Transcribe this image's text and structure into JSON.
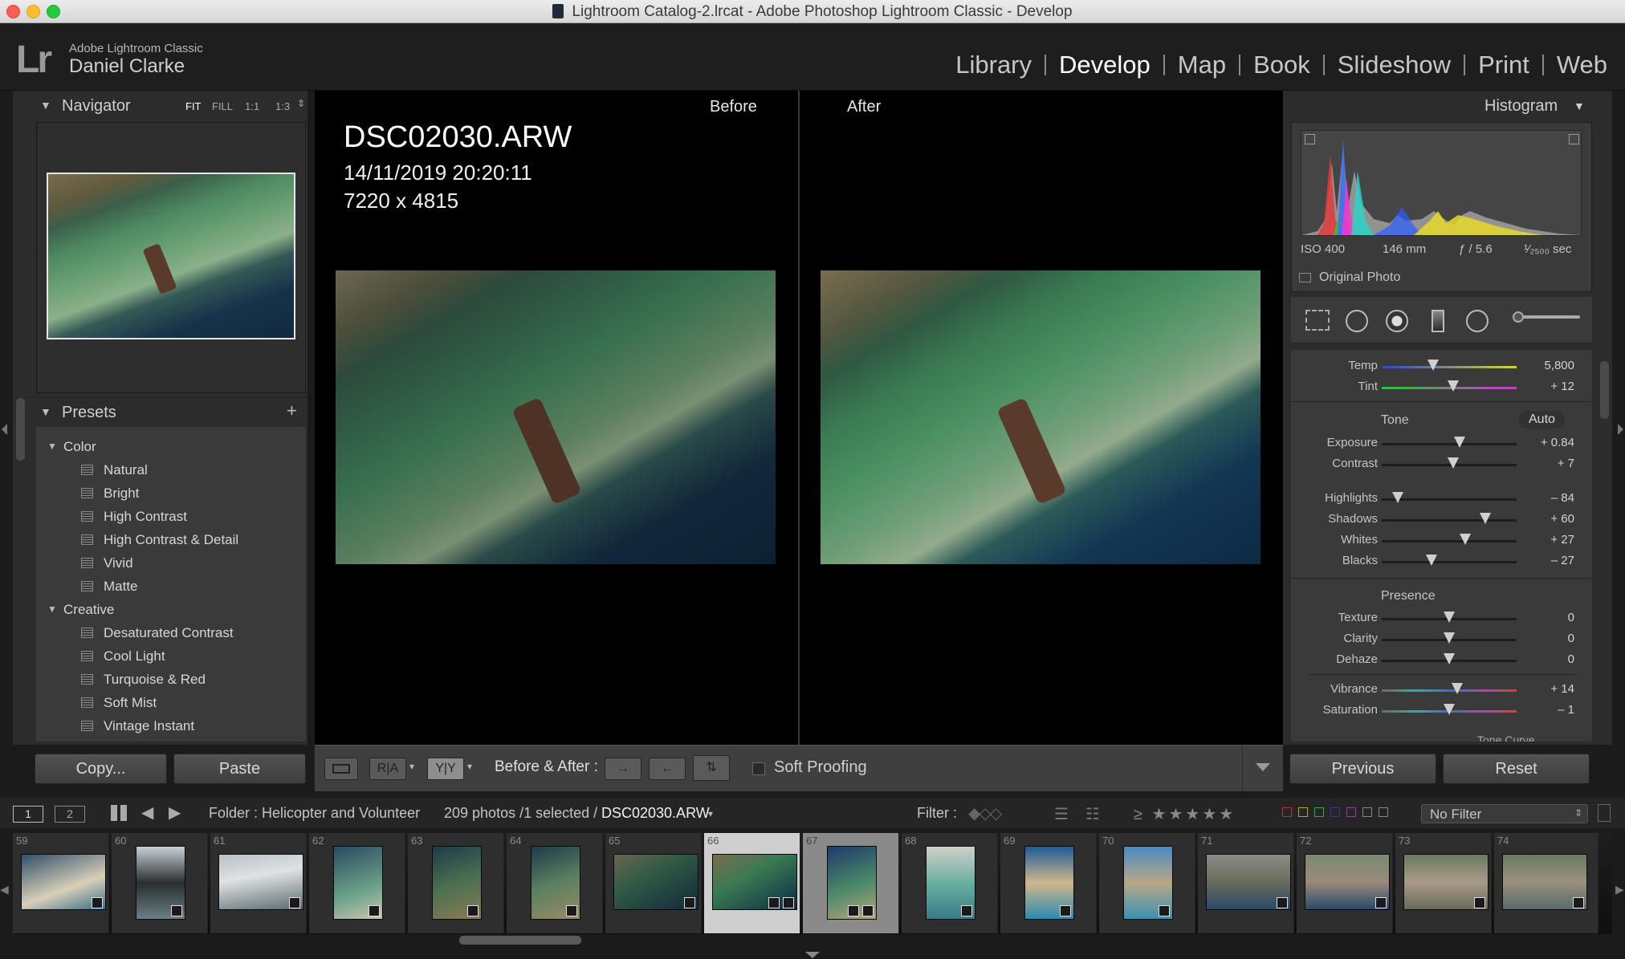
{
  "window": {
    "title": "Lightroom Catalog-2.lrcat - Adobe Photoshop Lightroom Classic - Develop"
  },
  "identity": {
    "logo": "Lr",
    "app_name": "Adobe Lightroom Classic",
    "user_name": "Daniel Clarke"
  },
  "modules": [
    {
      "label": "Library"
    },
    {
      "label": "Develop"
    },
    {
      "label": "Map"
    },
    {
      "label": "Book"
    },
    {
      "label": "Slideshow"
    },
    {
      "label": "Print"
    },
    {
      "label": "Web"
    }
  ],
  "navigator": {
    "title": "Navigator",
    "zoom": [
      "FIT",
      "FILL",
      "1:1",
      "1:3"
    ]
  },
  "presets": {
    "title": "Presets",
    "groups": [
      {
        "name": "Color",
        "items": [
          "Natural",
          "Bright",
          "High Contrast",
          "High Contrast & Detail",
          "Vivid",
          "Matte"
        ]
      },
      {
        "name": "Creative",
        "items": [
          "Desaturated Contrast",
          "Cool Light",
          "Turquoise & Red",
          "Soft Mist",
          "Vintage Instant"
        ]
      }
    ]
  },
  "left_buttons": {
    "copy": "Copy...",
    "paste": "Paste"
  },
  "center": {
    "before_label": "Before",
    "after_label": "After",
    "file_name": "DSC02030.ARW",
    "datetime": "14/11/2019 20:20:11",
    "dimensions": "7220 x 4815"
  },
  "toolbar": {
    "before_after_label": "Before & After :",
    "soft_proofing": "Soft Proofing"
  },
  "histogram": {
    "title": "Histogram",
    "iso": "ISO 400",
    "focal": "146 mm",
    "aperture": "ƒ / 5.6",
    "shutter": "¹⁄₂₅₀₀ sec",
    "original_photo": "Original Photo"
  },
  "basic": {
    "wb": [
      {
        "label": "Temp",
        "value": "5,800",
        "pos": 0.38
      },
      {
        "label": "Tint",
        "value": "+ 12",
        "pos": 0.53
      }
    ],
    "tone_title": "Tone",
    "auto": "Auto",
    "tone": [
      {
        "label": "Exposure",
        "value": "+ 0.84",
        "pos": 0.58
      },
      {
        "label": "Contrast",
        "value": "+ 7",
        "pos": 0.53
      },
      {
        "label": "Highlights",
        "value": "– 84",
        "pos": 0.12
      },
      {
        "label": "Shadows",
        "value": "+ 60",
        "pos": 0.77
      },
      {
        "label": "Whites",
        "value": "+ 27",
        "pos": 0.62
      },
      {
        "label": "Blacks",
        "value": "– 27",
        "pos": 0.37
      }
    ],
    "presence_title": "Presence",
    "presence": [
      {
        "label": "Texture",
        "value": "0",
        "pos": 0.5
      },
      {
        "label": "Clarity",
        "value": "0",
        "pos": 0.5
      },
      {
        "label": "Dehaze",
        "value": "0",
        "pos": 0.5
      },
      {
        "label": "Vibrance",
        "value": "+ 14",
        "pos": 0.56
      },
      {
        "label": "Saturation",
        "value": "– 1",
        "pos": 0.5
      }
    ],
    "tone_curve": "Tone Curve"
  },
  "right_buttons": {
    "previous": "Previous",
    "reset": "Reset"
  },
  "filmbar": {
    "screen1": "1",
    "screen2": "2",
    "source": "Folder : Helicopter and Volunteer",
    "count": "209 photos /1 selected /",
    "file": "DSC02030.ARW",
    "filter_label": "Filter :",
    "filter_value": "No Filter"
  },
  "filmstrip": [
    "59",
    "60",
    "61",
    "62",
    "63",
    "64",
    "65",
    "66",
    "67",
    "68",
    "69",
    "70",
    "71",
    "72",
    "73",
    "74"
  ],
  "colors": {
    "accent": "#ffffff",
    "panel": "#383838",
    "background": "#1b1b1b"
  }
}
